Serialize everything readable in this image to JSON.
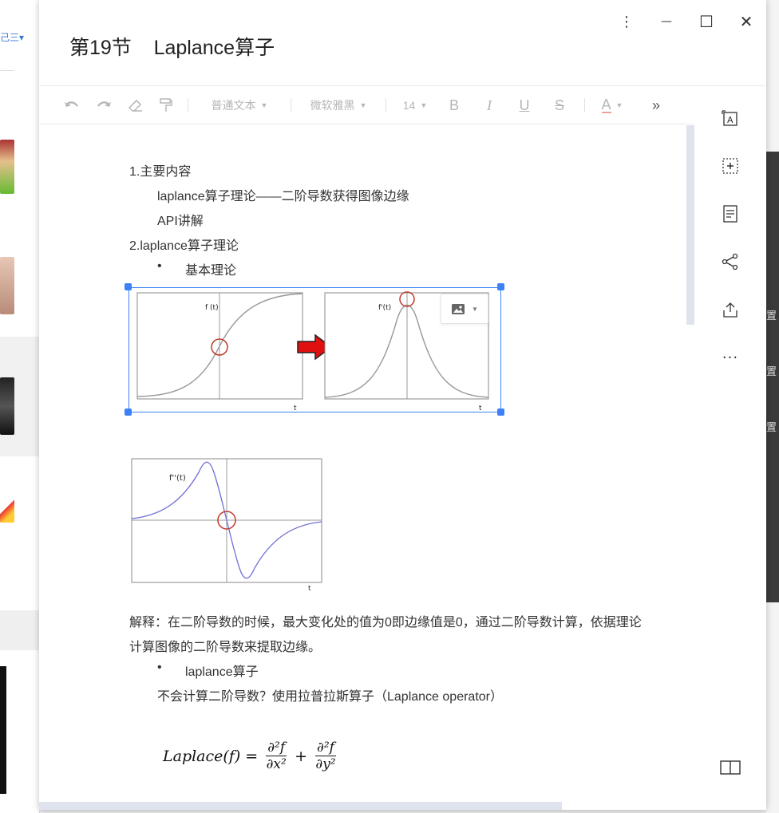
{
  "document": {
    "title": "第19节    Laplance算子"
  },
  "window_controls": {
    "more": "⋮",
    "minimize": "—",
    "maximize": "☐",
    "close": "✕"
  },
  "toolbar": {
    "paragraph_style": "普通文本",
    "font_family": "微软雅黑",
    "font_size": "14",
    "bold": "B",
    "italic": "I",
    "underline": "U",
    "strike": "S",
    "font_color": "A",
    "more": "»"
  },
  "content": {
    "h1": "1.主要内容",
    "item1": "laplance算子理论——二阶导数获得图像边缘",
    "item2": "API讲解",
    "h2": "2.laplance算子理论",
    "bullet1": "基本理论",
    "graph1": {
      "ylabel": "f (t)",
      "xlabel": "t"
    },
    "graph2": {
      "ylabel": "f'(t)",
      "xlabel": "t"
    },
    "graph3": {
      "ylabel": "f''(t)",
      "xlabel": "t"
    },
    "explain_line1": "解释：在二阶导数的时候，最大变化处的值为0即边缘值是0，通过二阶导数计算，依据理论",
    "explain_line2": "计算图像的二阶导数来提取边缘。",
    "bullet2": "laplance算子",
    "note": "不会计算二阶导数？使用拉普拉斯算子（Laplance  operator）"
  },
  "formula": {
    "lhs": "Laplace(f) =",
    "num1": "∂²f",
    "den1": "∂x²",
    "plus": "+",
    "num2": "∂²f",
    "den2": "∂y²"
  },
  "sidebar": {
    "ellipsis": "···"
  },
  "background": {
    "left_stub_text": "己三▾",
    "right_text_1": "置",
    "right_text_2": "置",
    "right_text_3": "置"
  },
  "colors": {
    "accent": "#3c82f6",
    "arrow_red": "#e01010",
    "curve_gray": "#9a9a9a",
    "curve_blue": "#6f6fd6",
    "circle": "#c0392b"
  }
}
